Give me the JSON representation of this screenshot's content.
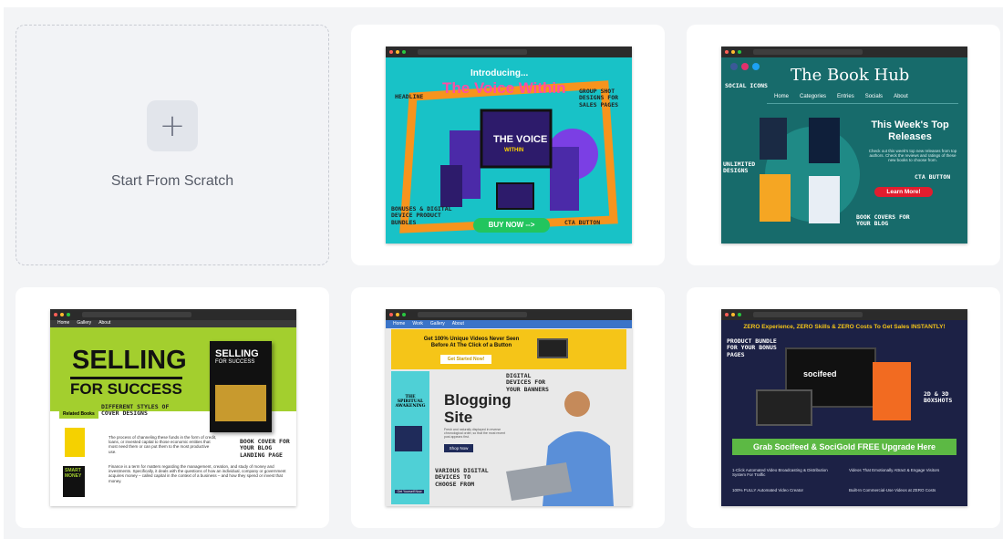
{
  "scratch": {
    "label": "Start From Scratch",
    "plus": "+"
  },
  "templates": [
    {
      "id": "voice",
      "kicker": "Introducing...",
      "title": "The Voice Within",
      "box_title": "THE VOICE",
      "box_sub": "WITHIN",
      "cta": "BUY NOW -->",
      "notes": [
        "HEADLINE",
        "GROUP SHOT DESIGNS FOR SALES PAGES",
        "BONUSES & DIGITAL DEVICE PRODUCT BUNDLES",
        "CTA BUTTON"
      ]
    },
    {
      "id": "bookhub",
      "title": "The Book Hub",
      "nav": [
        "Home",
        "Categories",
        "Entries",
        "Socials",
        "About"
      ],
      "heading": "This Week's Top Releases",
      "body": "Check out this week's top new releases from top authors. Check the reviews and ratings of these new books to choose from.",
      "cta": "Learn More!",
      "notes": [
        "SOCIAL ICONS",
        "UNLIMITED DESIGNS",
        "CTA BUTTON",
        "BOOK COVERS FOR YOUR BLOG"
      ]
    },
    {
      "id": "selling",
      "nav": [
        "Home",
        "Gallery",
        "About"
      ],
      "title_1": "SELLING",
      "title_2": "FOR SUCCESS",
      "book_title_1": "SELLING",
      "book_title_2": "FOR SUCCESS",
      "related": "Related Books",
      "p1": "The process of channeling these funds in the form of credit, loans, or invested capital to those economic entities that most need them or can put them to the most productive use.",
      "p2": "Finance is a term for matters regarding the management, creation, and study of money and investments. Specifically, it deals with the questions of how an individual, company or government acquires money – called capital in the context of a business – and how they spend or invest that money.",
      "mini_book": "SMART MONEY",
      "notes": [
        "DIFFERENT STYLES OF COVER DESIGNS",
        "BOOK COVER FOR YOUR BLOG LANDING PAGE"
      ]
    },
    {
      "id": "blogging",
      "nav": [
        "Home",
        "Work",
        "Gallery",
        "About"
      ],
      "banner": "Get 100% Unique Videos Never Seen Before At The Click of a Button",
      "banner_cta": "Get Started Now!",
      "book": "THE SPIRITUAL AWAKENING",
      "heading_1": "Blogging",
      "heading_2": "Site",
      "body": "Fresh and naturally displayed in reverse chronological order, so that the most recent post appears first.",
      "cta": "Shop Now",
      "side_cta": "Get Yourself Now",
      "notes": [
        "DIGITAL DEVICES FOR YOUR BANNERS",
        "VARIOUS DIGITAL DEVICES TO CHOOSE FROM"
      ]
    },
    {
      "id": "socifeed",
      "headline": "ZERO Experience, ZERO Skills & ZERO Costs To Get Sales INSTANTLY!",
      "brand": "socifeed",
      "cta": "Grab Socifeed & SociGold FREE Upgrade Here",
      "features": [
        "1-Click Automated Video Broadcasting & Distribution System For Traffic",
        "Videos That Emotionally Attract & Engage Visitors",
        "100% FULLY Automated Video Creator",
        "Built-In Commercial-Use Videos at ZERO Costs"
      ],
      "notes": [
        "PRODUCT BUNDLE FOR YOUR BONUS PAGES",
        "2D & 3D BOXSHOTS"
      ]
    }
  ],
  "colors": {
    "accent_pink": "#ff4fa3",
    "green_cta": "#22c55e",
    "teal": "#176b6b",
    "lime": "#a3cf2e",
    "navy": "#1c2145",
    "yellow": "#f5c518"
  }
}
